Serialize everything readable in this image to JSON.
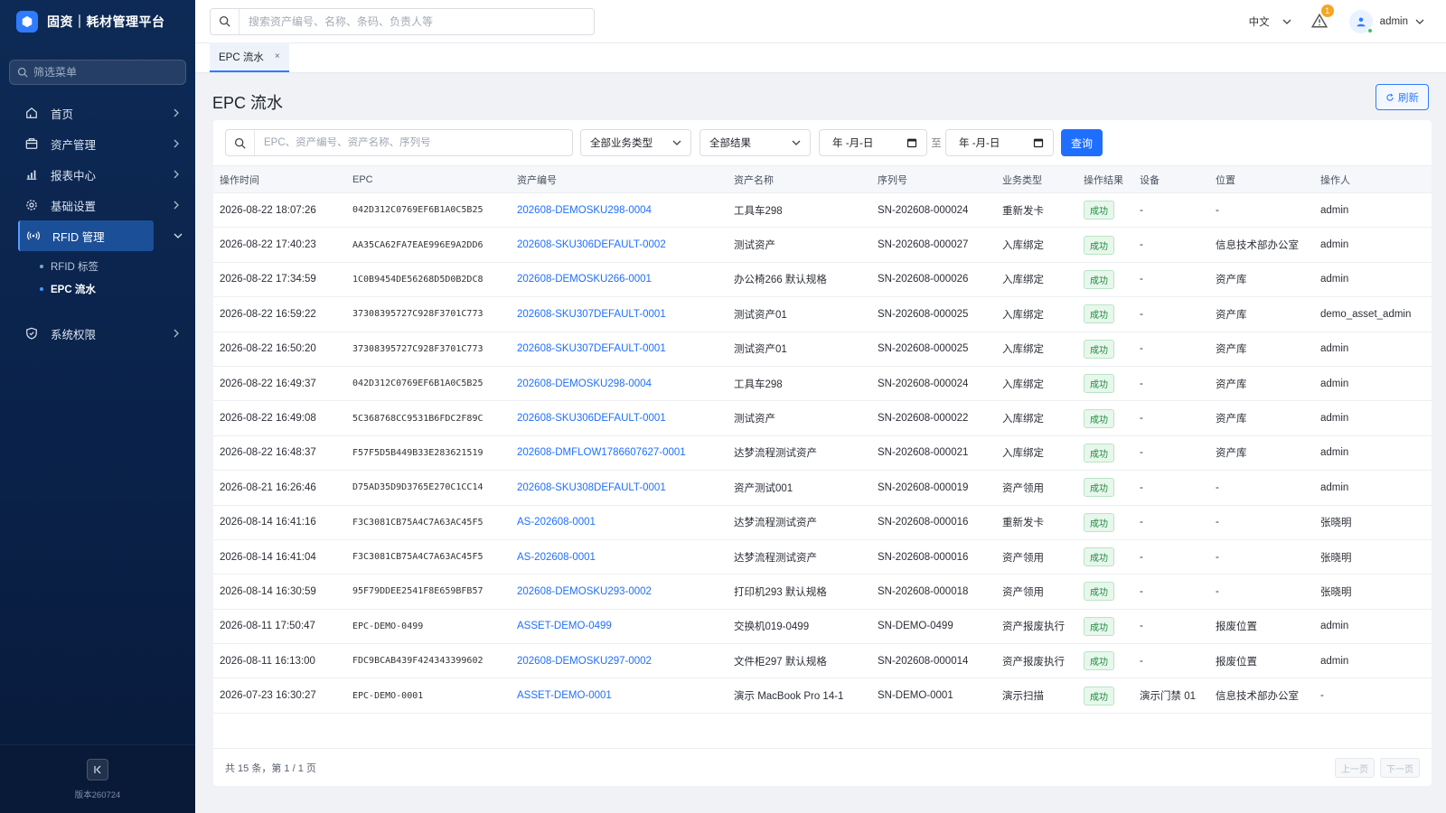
{
  "app": {
    "title": "固资｜耗材管理平台"
  },
  "sidebar": {
    "filter_placeholder": "筛选菜单",
    "items": [
      {
        "label": "首页",
        "icon": "home-icon"
      },
      {
        "label": "资产管理",
        "icon": "box-icon"
      },
      {
        "label": "报表中心",
        "icon": "bar-chart-icon"
      },
      {
        "label": "基础设置",
        "icon": "gear-icon"
      },
      {
        "label": "RFID 管理",
        "icon": "rfid-icon",
        "active": true,
        "children": [
          {
            "label": "RFID 标签"
          },
          {
            "label": "EPC 流水",
            "active": true
          }
        ]
      },
      {
        "label": "系统权限",
        "icon": "shield-icon"
      }
    ],
    "version": "版本260724"
  },
  "header": {
    "search_placeholder": "搜索资产编号、名称、条码、负责人等",
    "language": "中文",
    "alert_count": "1",
    "user": "admin"
  },
  "tabs": [
    {
      "label": "EPC 流水",
      "close": "×"
    }
  ],
  "page": {
    "title": "EPC 流水",
    "refresh_label": "刷新"
  },
  "filters": {
    "search_placeholder": "EPC、资产编号、资产名称、序列号",
    "business_type": "全部业务类型",
    "result": "全部结果",
    "date_from": "年 -月-日",
    "date_sep": "至",
    "date_to": "年 -月-日",
    "query_label": "查询"
  },
  "table": {
    "columns": [
      "操作时间",
      "EPC",
      "资产编号",
      "资产名称",
      "序列号",
      "业务类型",
      "操作结果",
      "设备",
      "位置",
      "操作人"
    ],
    "rows": [
      [
        "2026-08-22 18:07:26",
        "042D312C0769EF6B1A0C5B25",
        "202608-DEMOSKU298-0004",
        "工具车298",
        "SN-202608-000024",
        "重新发卡",
        "成功",
        "-",
        "-",
        "admin"
      ],
      [
        "2026-08-22 17:40:23",
        "AA35CA62FA7EAE996E9A2DD6",
        "202608-SKU306DEFAULT-0002",
        "测试资产",
        "SN-202608-000027",
        "入库绑定",
        "成功",
        "-",
        "信息技术部办公室",
        "admin"
      ],
      [
        "2026-08-22 17:34:59",
        "1C0B9454DE56268D5D0B2DC8",
        "202608-DEMOSKU266-0001",
        "办公椅266 默认规格",
        "SN-202608-000026",
        "入库绑定",
        "成功",
        "-",
        "资产库",
        "admin"
      ],
      [
        "2026-08-22 16:59:22",
        "37308395727C928F3701C773",
        "202608-SKU307DEFAULT-0001",
        "测试资产01",
        "SN-202608-000025",
        "入库绑定",
        "成功",
        "-",
        "资产库",
        "demo_asset_admin"
      ],
      [
        "2026-08-22 16:50:20",
        "37308395727C928F3701C773",
        "202608-SKU307DEFAULT-0001",
        "测试资产01",
        "SN-202608-000025",
        "入库绑定",
        "成功",
        "-",
        "资产库",
        "admin"
      ],
      [
        "2026-08-22 16:49:37",
        "042D312C0769EF6B1A0C5B25",
        "202608-DEMOSKU298-0004",
        "工具车298",
        "SN-202608-000024",
        "入库绑定",
        "成功",
        "-",
        "资产库",
        "admin"
      ],
      [
        "2026-08-22 16:49:08",
        "5C368768CC9531B6FDC2F89C",
        "202608-SKU306DEFAULT-0001",
        "测试资产",
        "SN-202608-000022",
        "入库绑定",
        "成功",
        "-",
        "资产库",
        "admin"
      ],
      [
        "2026-08-22 16:48:37",
        "F57F5D5B449B33E283621519",
        "202608-DMFLOW1786607627-0001",
        "达梦流程测试资产",
        "SN-202608-000021",
        "入库绑定",
        "成功",
        "-",
        "资产库",
        "admin"
      ],
      [
        "2026-08-21 16:26:46",
        "D75AD35D9D3765E270C1CC14",
        "202608-SKU308DEFAULT-0001",
        "资产测试001",
        "SN-202608-000019",
        "资产领用",
        "成功",
        "-",
        "-",
        "admin"
      ],
      [
        "2026-08-14 16:41:16",
        "F3C3081CB75A4C7A63AC45F5",
        "AS-202608-0001",
        "达梦流程测试资产",
        "SN-202608-000016",
        "重新发卡",
        "成功",
        "-",
        "-",
        "张晓明"
      ],
      [
        "2026-08-14 16:41:04",
        "F3C3081CB75A4C7A63AC45F5",
        "AS-202608-0001",
        "达梦流程测试资产",
        "SN-202608-000016",
        "资产领用",
        "成功",
        "-",
        "-",
        "张晓明"
      ],
      [
        "2026-08-14 16:30:59",
        "95F79DDEE2541F8E659BFB57",
        "202608-DEMOSKU293-0002",
        "打印机293 默认规格",
        "SN-202608-000018",
        "资产领用",
        "成功",
        "-",
        "-",
        "张晓明"
      ],
      [
        "2026-08-11 17:50:47",
        "EPC-DEMO-0499",
        "ASSET-DEMO-0499",
        "交换机019-0499",
        "SN-DEMO-0499",
        "资产报废执行",
        "成功",
        "-",
        "报废位置",
        "admin"
      ],
      [
        "2026-08-11 16:13:00",
        "FDC9BCAB439F424343399602",
        "202608-DEMOSKU297-0002",
        "文件柜297 默认规格",
        "SN-202608-000014",
        "资产报废执行",
        "成功",
        "-",
        "报废位置",
        "admin"
      ],
      [
        "2026-07-23 16:30:27",
        "EPC-DEMO-0001",
        "ASSET-DEMO-0001",
        "演示 MacBook Pro 14-1",
        "SN-DEMO-0001",
        "演示扫描",
        "成功",
        "演示门禁 01",
        "信息技术部办公室",
        "-"
      ]
    ]
  },
  "footer": {
    "summary": "共 15 条，第 1 / 1 页",
    "prev_label": "上一页",
    "next_label": "下一页"
  },
  "colors": {
    "accent": "#1f6fff",
    "sidebar": "#0d2a56",
    "success": "#1c8a3e"
  }
}
